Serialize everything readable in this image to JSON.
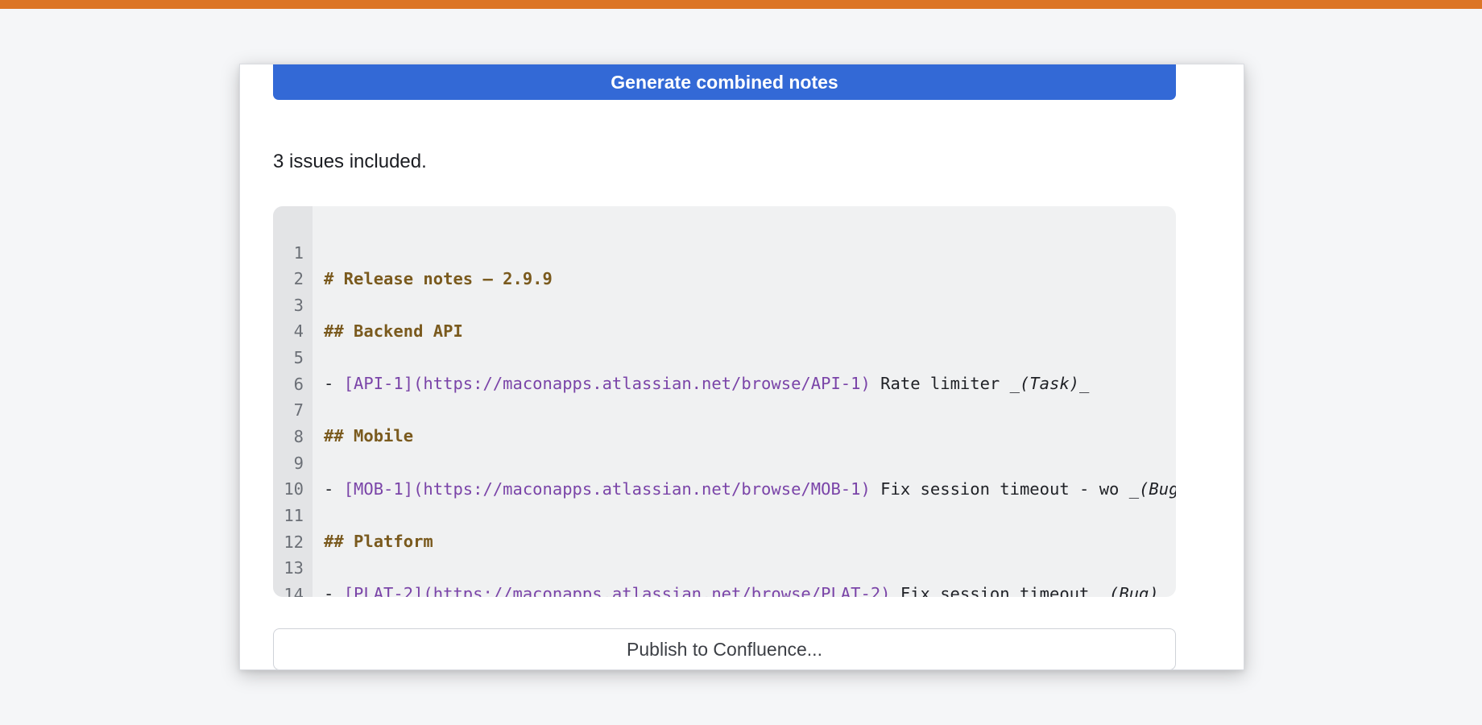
{
  "colors": {
    "top_accent": "#dc7526",
    "primary_button": "#3369d6",
    "markdown_heading": "#7a5a1e",
    "markdown_link": "#7a44a8"
  },
  "generate_button": {
    "label": "Generate combined notes"
  },
  "summary_text": "3 issues included.",
  "editor": {
    "lines": [
      {
        "number": "1",
        "heading": "# Release notes — 2.9.9"
      },
      {
        "number": "2"
      },
      {
        "number": "3",
        "heading": "## Backend API"
      },
      {
        "number": "4"
      },
      {
        "number": "5",
        "prefix": "- ",
        "link": "[API-1](https://maconapps.atlassian.net/browse/API-1)",
        "text": " Rate limiter _",
        "em": "(Task)",
        "suffix": "_"
      },
      {
        "number": "6"
      },
      {
        "number": "7",
        "heading": "## Mobile"
      },
      {
        "number": "8"
      },
      {
        "number": "9",
        "prefix": "- ",
        "link": "[MOB-1](https://maconapps.atlassian.net/browse/MOB-1)",
        "text": " Fix session timeout - wo _",
        "em": "(Bug)",
        "suffix": "_"
      },
      {
        "number": "10"
      },
      {
        "number": "11",
        "heading": "## Platform"
      },
      {
        "number": "12"
      },
      {
        "number": "13",
        "prefix": "- ",
        "link": "[PLAT-2](https://maconapps.atlassian.net/browse/PLAT-2)",
        "text": " Fix session timeout _",
        "em": "(Bug)",
        "suffix": "_"
      },
      {
        "number": "14"
      }
    ]
  },
  "publish_button": {
    "label": "Publish to Confluence..."
  }
}
